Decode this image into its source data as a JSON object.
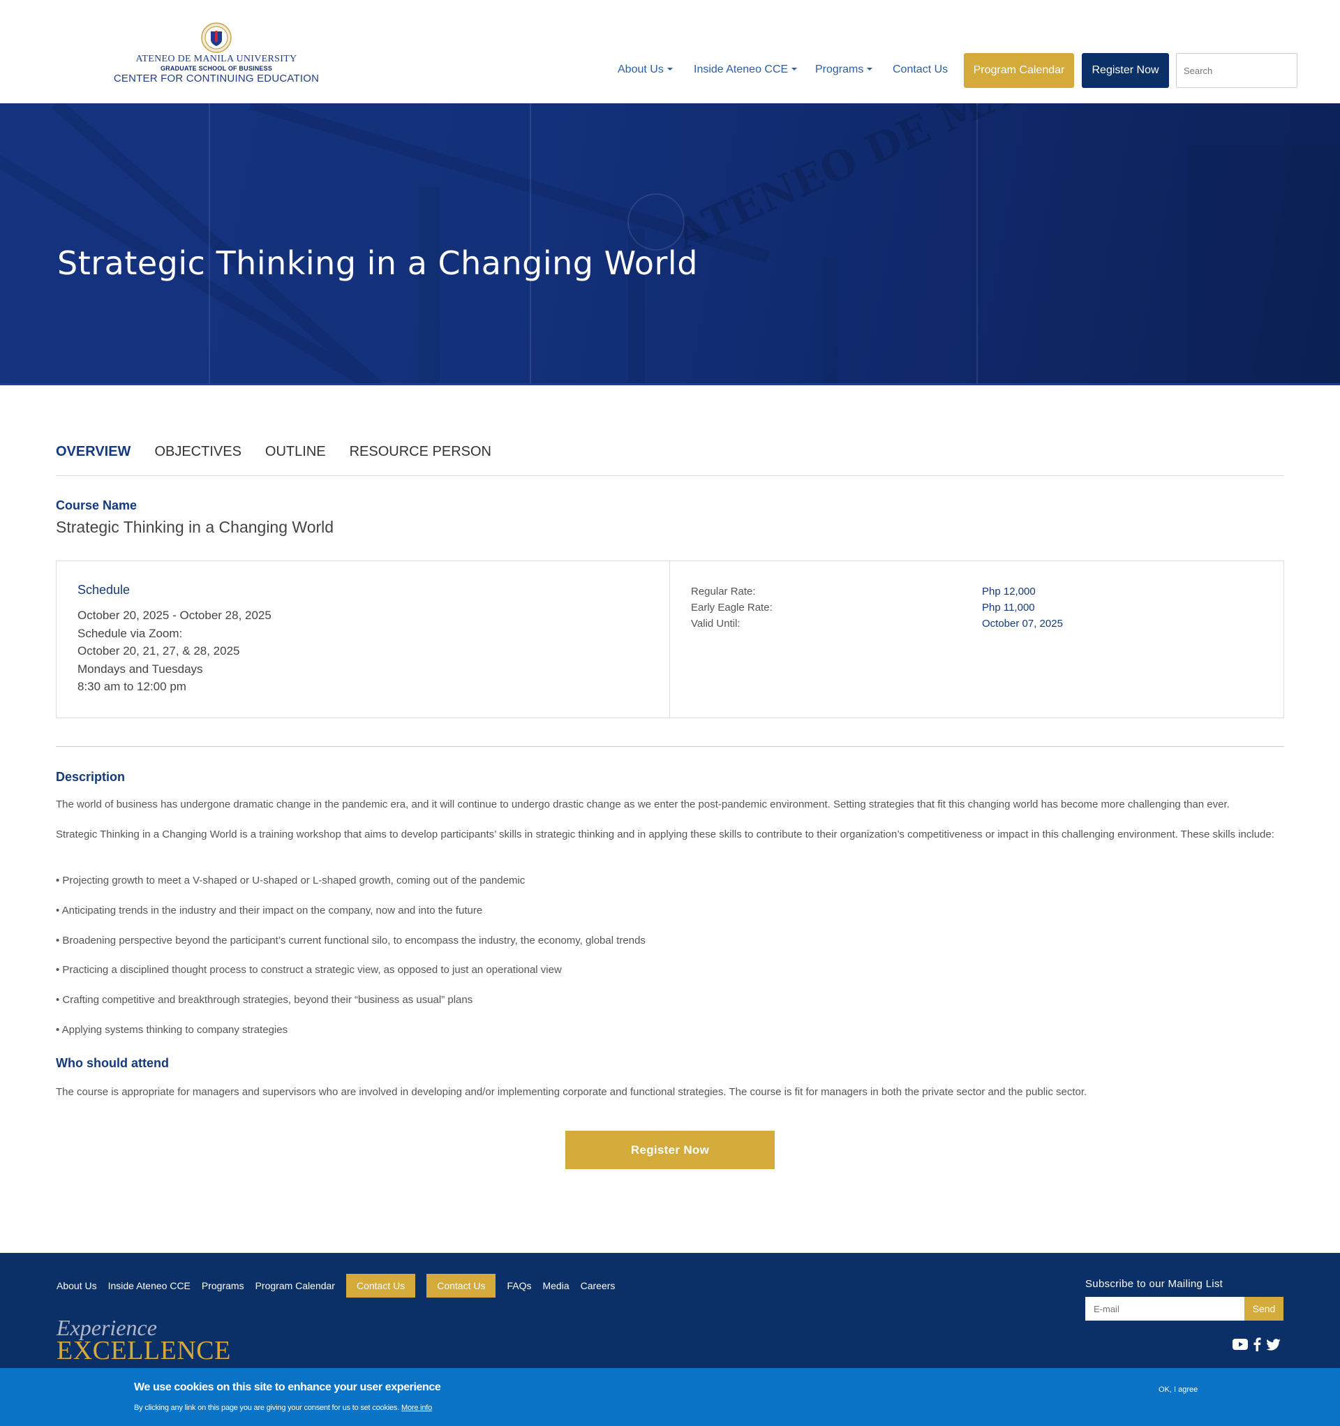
{
  "header": {
    "logo": {
      "university": "ATENEO DE MANILA UNIVERSITY",
      "school": "GRADUATE SCHOOL OF BUSINESS",
      "center": "CENTER FOR CONTINUING EDUCATION"
    },
    "nav": {
      "about": "About Us",
      "inside": "Inside Ateneo CCE",
      "programs": "Programs",
      "contact": "Contact Us"
    },
    "program_calendar": "Program Calendar",
    "register_now": "Register Now",
    "search_placeholder": "Search"
  },
  "hero": {
    "title": "Strategic Thinking in a Changing World",
    "watermark": "ATENEO DE MANILA UNIVERSITY"
  },
  "tabs": [
    "OVERVIEW",
    "OBJECTIVES",
    "OUTLINE",
    "RESOURCE PERSON"
  ],
  "course": {
    "label": "Course Name",
    "name": "Strategic Thinking in a Changing World"
  },
  "schedule": {
    "title": "Schedule",
    "lines": [
      "October 20, 2025 - October 28, 2025",
      "Schedule via Zoom:",
      "October 20, 21, 27, & 28, 2025",
      "Mondays and Tuesdays",
      "8:30 am to 12:00 pm"
    ]
  },
  "rates": [
    {
      "label": "Regular Rate:",
      "value": "Php 12,000"
    },
    {
      "label": "Early Eagle Rate:",
      "value": "Php 11,000"
    },
    {
      "label": "Valid Until:",
      "value": "October 07, 2025"
    }
  ],
  "description": {
    "label": "Description",
    "paragraphs": [
      "The world of business has undergone dramatic change in the pandemic era, and it will continue to undergo drastic change as we enter the post-pandemic environment. Setting strategies that fit this changing world has become more challenging than ever.",
      "Strategic Thinking in a Changing World is a training workshop that aims to develop participants’ skills in strategic thinking and in applying these skills to contribute to their organization’s competitiveness or impact in this challenging environment. These skills include:",
      "• Projecting growth to meet a V-shaped or U-shaped or L-shaped growth, coming out of the pandemic",
      "• Anticipating trends in the industry and their impact on the company, now and into the future",
      "• Broadening perspective beyond the participant’s current functional silo, to encompass the industry, the economy, global trends",
      "• Practicing a disciplined thought process to construct a strategic view, as opposed to just an operational view",
      "• Crafting competitive and breakthrough strategies, beyond their “business as usual” plans",
      "• Applying systems thinking to company strategies"
    ]
  },
  "who": {
    "label": "Who should attend",
    "text": "The course is appropriate for managers and supervisors who are involved in developing and/or implementing corporate and functional strategies. The course is fit for managers in both the private sector and the public sector."
  },
  "register_button": "Register Now",
  "footer": {
    "links": [
      "About Us",
      "Inside Ateneo CCE",
      "Programs",
      "Program Calendar",
      "Contact Us",
      "Contact Us",
      "FAQs",
      "Media",
      "Careers"
    ],
    "tagline_1": "Experience",
    "tagline_2": "EXCELLENCE",
    "subscribe_title": "Subscribe to our Mailing List",
    "email_placeholder": "E-mail",
    "send": "Send",
    "socials": [
      "youtube-icon",
      "facebook-icon",
      "twitter-icon"
    ]
  },
  "cookie": {
    "title": "We use cookies on this site to enhance your user experience",
    "text": "By clicking any link on this page you are giving your consent for us to set cookies.",
    "more_info": "More info",
    "ok": "OK, I agree"
  },
  "colors": {
    "navy": "#0b2f67",
    "gold": "#d4aa3b",
    "link_blue": "#2a5fa8",
    "cookie_blue": "#0a73c5"
  }
}
